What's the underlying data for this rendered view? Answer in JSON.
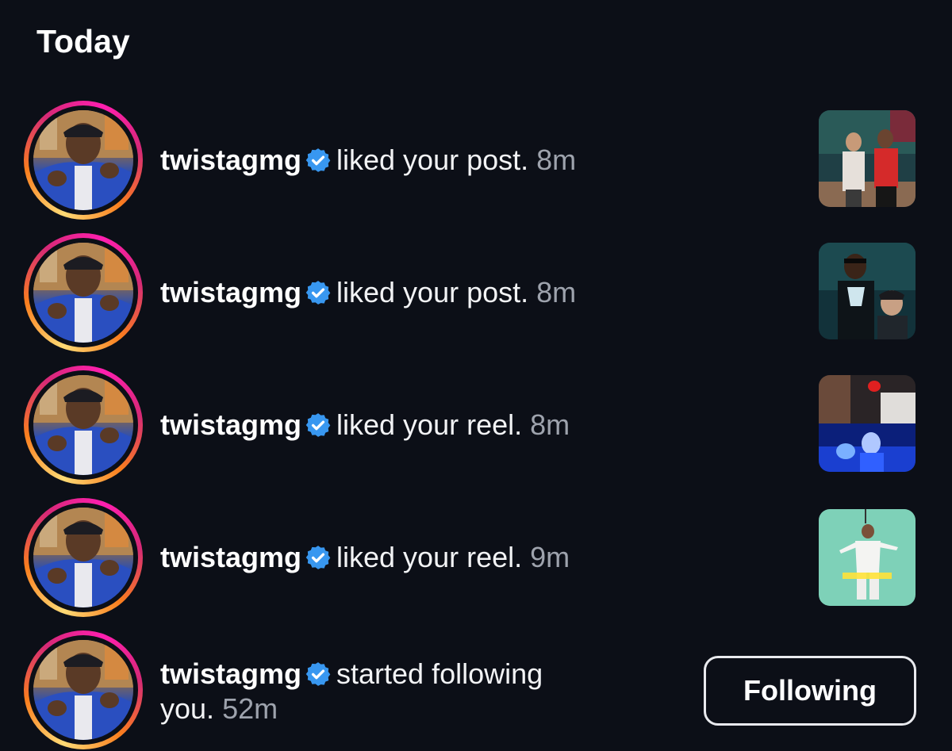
{
  "section": {
    "title": "Today"
  },
  "notifications": [
    {
      "username": "twistagmg",
      "action": "liked your post.",
      "time": "8m",
      "thumb": "post-thumbnail"
    },
    {
      "username": "twistagmg",
      "action": "liked your post.",
      "time": "8m",
      "thumb": "post-thumbnail"
    },
    {
      "username": "twistagmg",
      "action": "liked your reel.",
      "time": "8m",
      "thumb": "reel-thumbnail"
    },
    {
      "username": "twistagmg",
      "action": "liked your reel.",
      "time": "9m",
      "thumb": "reel-thumbnail"
    },
    {
      "username": "twistagmg",
      "action_line1": "started following",
      "action_line2": "you.",
      "time": "52m"
    }
  ],
  "follow_button": {
    "label": "Following"
  },
  "colors": {
    "background": "#0c0f17",
    "verified": "#3897f0",
    "timestamp": "#9ea3ad",
    "story_ring": [
      "#feda75",
      "#fa7e1e",
      "#d62976",
      "#ff1fb0"
    ]
  }
}
